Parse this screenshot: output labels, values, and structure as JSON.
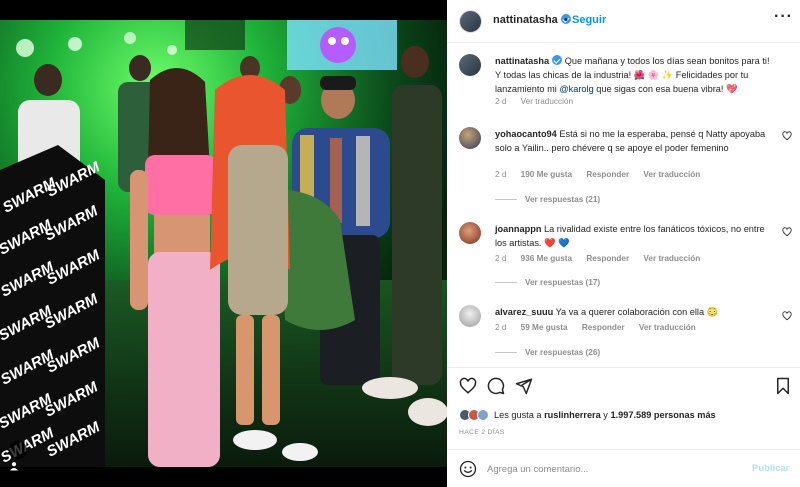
{
  "post": {
    "username": "nattinatasha",
    "follow_label": "Seguir",
    "separator": "•",
    "more_icon": "more-horizontal-icon"
  },
  "caption": {
    "username": "nattinatasha",
    "text_before": "Que mañana y todos los días sean bonitos para ti! Y todas las chicas de la industria! 🌺 🌸 ✨ Felicidades por tu lanzamiento mi ",
    "mention": "@karolg",
    "text_after": " que sigas con esa buena vibra! 💖",
    "age": "2 d",
    "translate": "Ver traducción"
  },
  "comments": [
    {
      "username": "yohaocanto94",
      "text": "Está si no me la esperaba, pensé q Natty apoyaba solo a Yailin.. pero chévere q se apoye el poder femenino",
      "age": "2 d",
      "likes": "190 Me gusta",
      "reply": "Responder",
      "translate": "Ver traducción",
      "view_replies": "Ver respuestas (21)"
    },
    {
      "username": "joannappn",
      "text": "La rivalidad existe entre los fanáticos tóxicos, no entre los artistas. ❤️ 💙",
      "age": "2 d",
      "likes": "936 Me gusta",
      "reply": "Responder",
      "translate": "Ver traducción",
      "view_replies": "Ver respuestas (17)"
    },
    {
      "username": "alvarez_suuu",
      "text": "Ya va a querer colaboración con ella 😳",
      "age": "2 d",
      "likes": "59 Me gusta",
      "reply": "Responder",
      "translate": "Ver traducción",
      "view_replies": "Ver respuestas (26)"
    }
  ],
  "likes": {
    "prefix": "Les gusta a ",
    "user": "ruslinherrera",
    "middle": " y ",
    "count": "1.997.589 personas más"
  },
  "posted_ago": "HACE 2 DÍAS",
  "comment_box": {
    "placeholder": "Agrega un comentario...",
    "post_label": "Publicar"
  },
  "photo": {
    "banner_words": [
      "SWARM",
      "SWARM",
      "SWARM",
      "SWARM",
      "SWARM",
      "SWARM",
      "SWARM",
      "SWARM",
      "SWARM",
      "SWARM",
      "SWARM",
      "SWARM",
      "SWARM",
      "SWARM"
    ]
  },
  "colors": {
    "link_blue": "#0095f6",
    "muted": "#8e8e8e",
    "text": "#262626",
    "like_red": "#ed4956"
  }
}
